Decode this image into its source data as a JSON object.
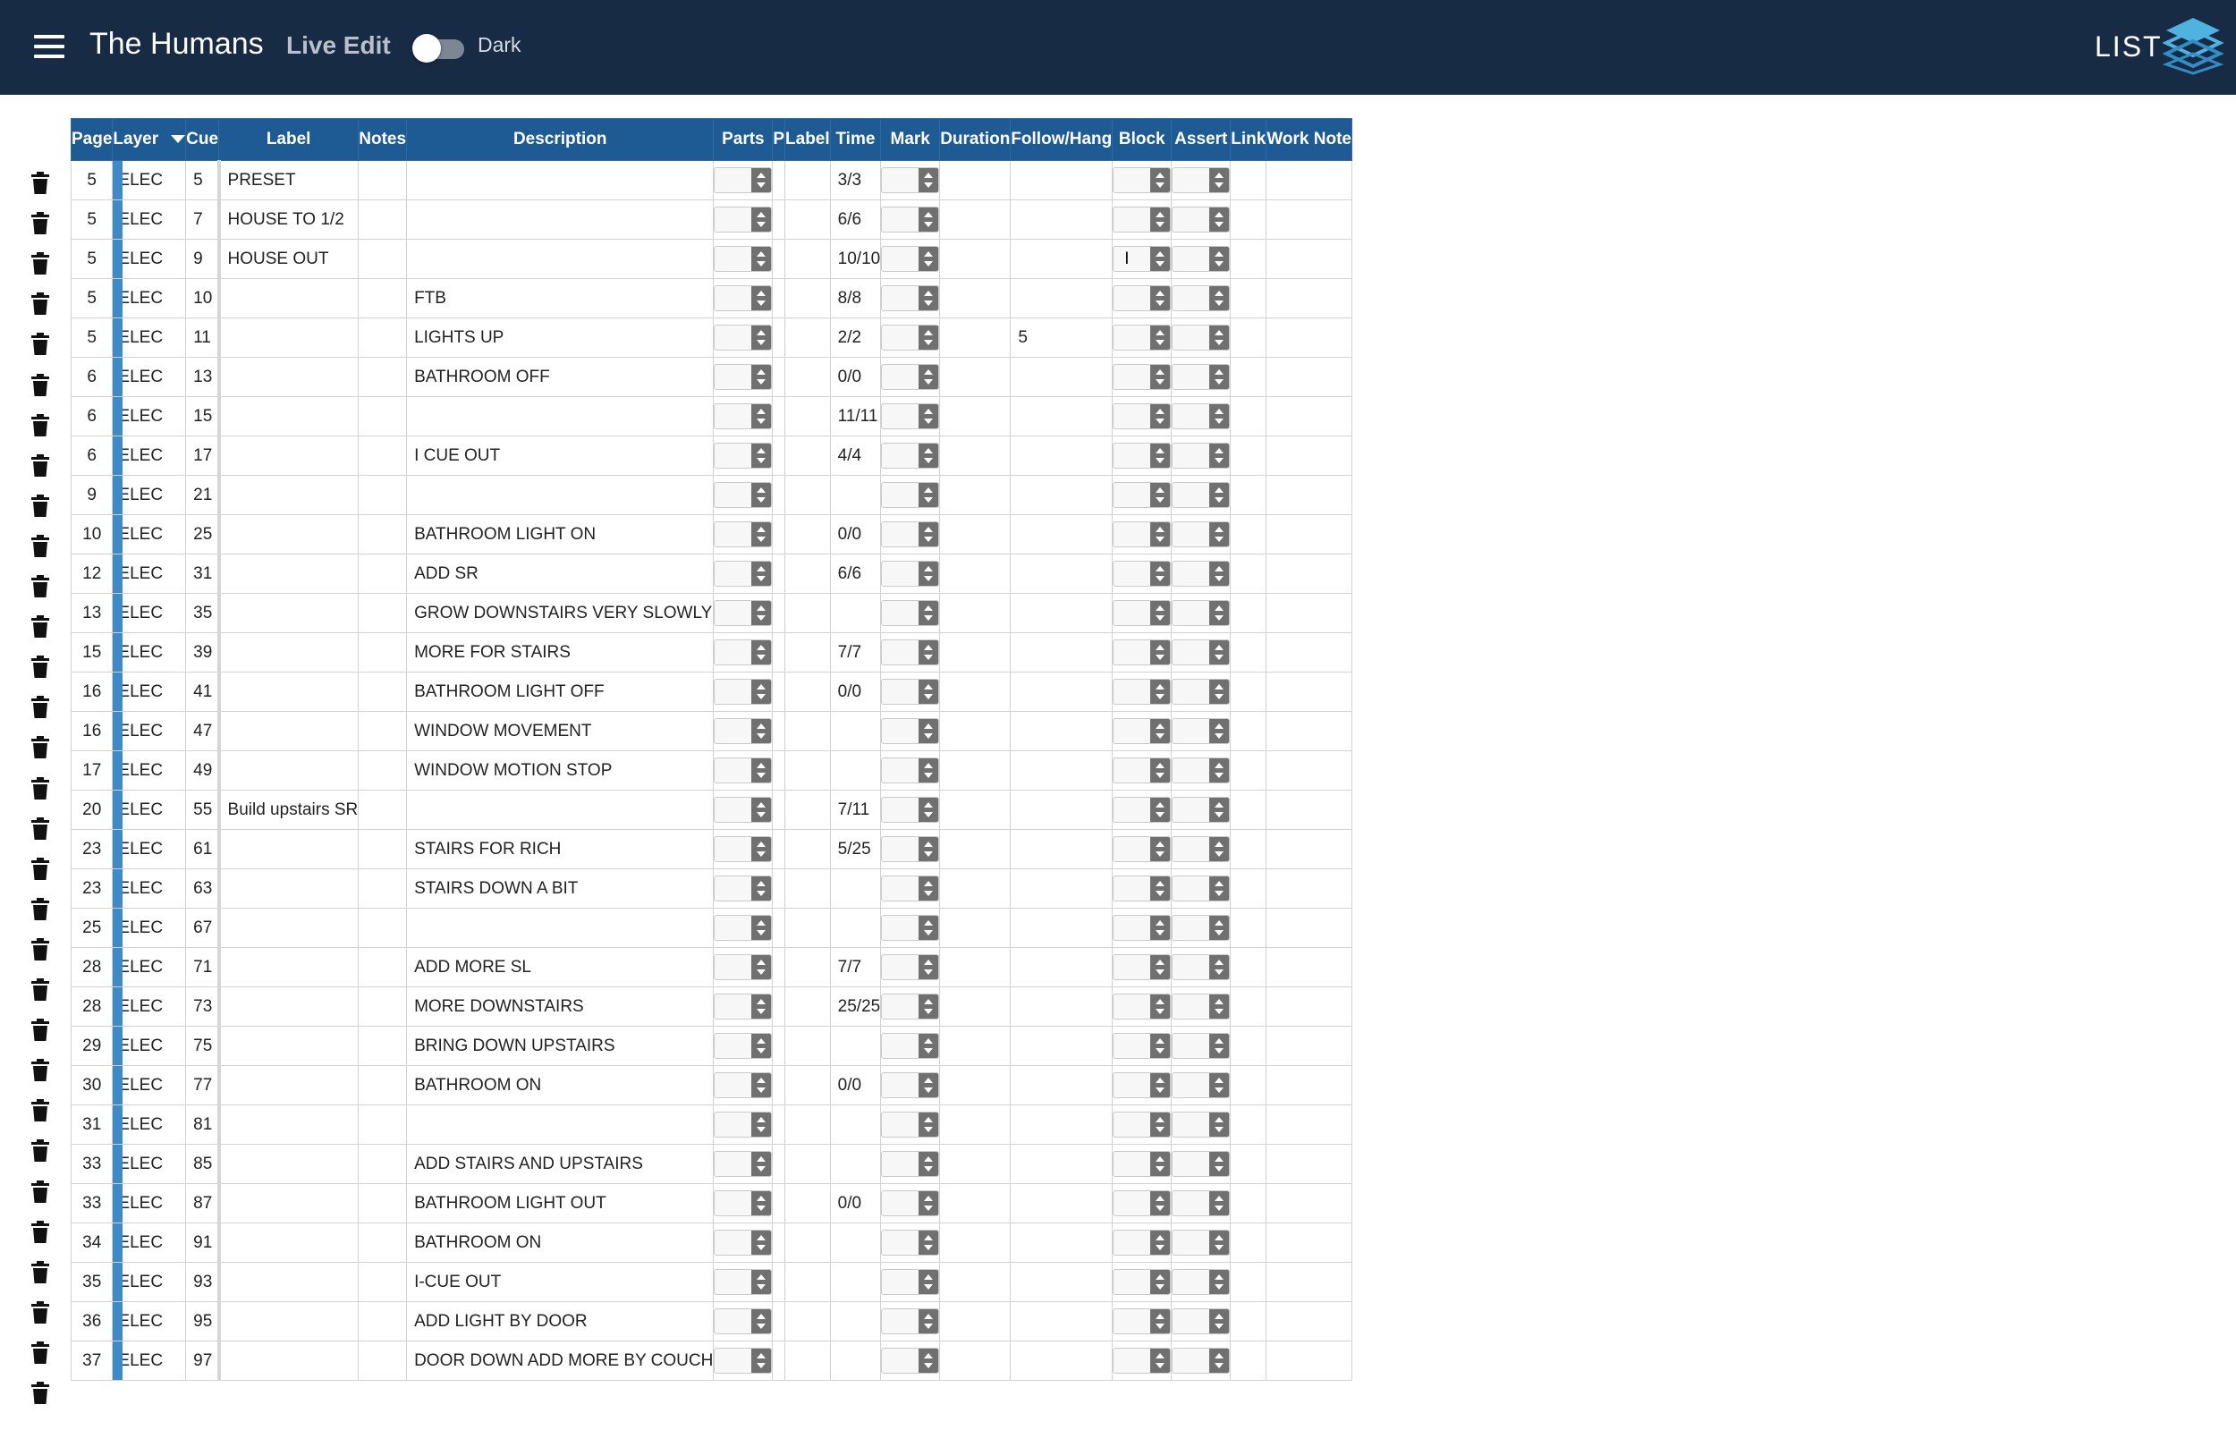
{
  "header": {
    "title": "The Humans",
    "live_edit": "Live Edit",
    "dark_label": "Dark",
    "logo_text": "LIST",
    "menu_icon": "hamburger-menu-icon",
    "dark_toggle_on": false,
    "colors": {
      "header_bg": "#172b45",
      "table_header_bg": "#1e5b94",
      "layer_bar": "#3d8ac8"
    }
  },
  "columns": {
    "page": "Page",
    "layer": "Layer",
    "cue": "Cue",
    "label": "Label",
    "notes": "Notes",
    "description": "Description",
    "parts": "Parts",
    "p": "P",
    "label2": "Label",
    "time": "Time",
    "mark": "Mark",
    "duration": "Duration",
    "follow_hang": "Follow/Hang",
    "block": "Block",
    "assert": "Assert",
    "link": "Link",
    "work_note": "Work Note"
  },
  "rows": [
    {
      "page": "5",
      "layer": "ELEC",
      "cue": "5",
      "label": "PRESET",
      "notes": "",
      "description": "",
      "time": "3/3",
      "follow": "",
      "block": ""
    },
    {
      "page": "5",
      "layer": "ELEC",
      "cue": "7",
      "label": "HOUSE TO 1/2",
      "notes": "",
      "description": "",
      "time": "6/6",
      "follow": "",
      "block": ""
    },
    {
      "page": "5",
      "layer": "ELEC",
      "cue": "9",
      "label": "HOUSE OUT",
      "notes": "",
      "description": "",
      "time": "10/10",
      "follow": "",
      "block": "I"
    },
    {
      "page": "5",
      "layer": "ELEC",
      "cue": "10",
      "label": "",
      "notes": "",
      "description": "FTB",
      "time": "8/8",
      "follow": "",
      "block": ""
    },
    {
      "page": "5",
      "layer": "ELEC",
      "cue": "11",
      "label": "",
      "notes": "",
      "description": "LIGHTS UP",
      "time": "2/2",
      "follow": "5",
      "block": ""
    },
    {
      "page": "6",
      "layer": "ELEC",
      "cue": "13",
      "label": "",
      "notes": "",
      "description": "BATHROOM OFF",
      "time": "0/0",
      "follow": "",
      "block": ""
    },
    {
      "page": "6",
      "layer": "ELEC",
      "cue": "15",
      "label": "",
      "notes": "",
      "description": "",
      "time": "11/11",
      "follow": "",
      "block": ""
    },
    {
      "page": "6",
      "layer": "ELEC",
      "cue": "17",
      "label": "",
      "notes": "",
      "description": "I CUE OUT",
      "time": "4/4",
      "follow": "",
      "block": ""
    },
    {
      "page": "9",
      "layer": "ELEC",
      "cue": "21",
      "label": "",
      "notes": "",
      "description": "",
      "time": "",
      "follow": "",
      "block": ""
    },
    {
      "page": "10",
      "layer": "ELEC",
      "cue": "25",
      "label": "",
      "notes": "",
      "description": "BATHROOM LIGHT ON",
      "time": "0/0",
      "follow": "",
      "block": ""
    },
    {
      "page": "12",
      "layer": "ELEC",
      "cue": "31",
      "label": "",
      "notes": "",
      "description": "ADD SR",
      "time": "6/6",
      "follow": "",
      "block": ""
    },
    {
      "page": "13",
      "layer": "ELEC",
      "cue": "35",
      "label": "",
      "notes": "",
      "description": "GROW DOWNSTAIRS VERY SLOWLY",
      "time": "",
      "follow": "",
      "block": ""
    },
    {
      "page": "15",
      "layer": "ELEC",
      "cue": "39",
      "label": "",
      "notes": "",
      "description": "MORE FOR STAIRS",
      "time": "7/7",
      "follow": "",
      "block": ""
    },
    {
      "page": "16",
      "layer": "ELEC",
      "cue": "41",
      "label": "",
      "notes": "",
      "description": "BATHROOM LIGHT OFF",
      "time": "0/0",
      "follow": "",
      "block": ""
    },
    {
      "page": "16",
      "layer": "ELEC",
      "cue": "47",
      "label": "",
      "notes": "",
      "description": "WINDOW MOVEMENT",
      "time": "",
      "follow": "",
      "block": ""
    },
    {
      "page": "17",
      "layer": "ELEC",
      "cue": "49",
      "label": "",
      "notes": "",
      "description": "WINDOW MOTION STOP",
      "time": "",
      "follow": "",
      "block": ""
    },
    {
      "page": "20",
      "layer": "ELEC",
      "cue": "55",
      "label": "Build upstairs SR",
      "notes": "",
      "description": "",
      "time": "7/11",
      "follow": "",
      "block": ""
    },
    {
      "page": "23",
      "layer": "ELEC",
      "cue": "61",
      "label": "",
      "notes": "",
      "description": "STAIRS FOR RICH",
      "time": "5/25",
      "follow": "",
      "block": ""
    },
    {
      "page": "23",
      "layer": "ELEC",
      "cue": "63",
      "label": "",
      "notes": "",
      "description": "STAIRS DOWN A BIT",
      "time": "",
      "follow": "",
      "block": ""
    },
    {
      "page": "25",
      "layer": "ELEC",
      "cue": "67",
      "label": "",
      "notes": "",
      "description": "",
      "time": "",
      "follow": "",
      "block": ""
    },
    {
      "page": "28",
      "layer": "ELEC",
      "cue": "71",
      "label": "",
      "notes": "",
      "description": "ADD MORE SL",
      "time": "7/7",
      "follow": "",
      "block": ""
    },
    {
      "page": "28",
      "layer": "ELEC",
      "cue": "73",
      "label": "",
      "notes": "",
      "description": "MORE DOWNSTAIRS",
      "time": "25/25",
      "follow": "",
      "block": ""
    },
    {
      "page": "29",
      "layer": "ELEC",
      "cue": "75",
      "label": "",
      "notes": "",
      "description": "BRING DOWN UPSTAIRS",
      "time": "",
      "follow": "",
      "block": ""
    },
    {
      "page": "30",
      "layer": "ELEC",
      "cue": "77",
      "label": "",
      "notes": "",
      "description": "BATHROOM ON",
      "time": "0/0",
      "follow": "",
      "block": ""
    },
    {
      "page": "31",
      "layer": "ELEC",
      "cue": "81",
      "label": "",
      "notes": "",
      "description": "",
      "time": "",
      "follow": "",
      "block": ""
    },
    {
      "page": "33",
      "layer": "ELEC",
      "cue": "85",
      "label": "",
      "notes": "",
      "description": "ADD STAIRS AND UPSTAIRS",
      "time": "",
      "follow": "",
      "block": ""
    },
    {
      "page": "33",
      "layer": "ELEC",
      "cue": "87",
      "label": "",
      "notes": "",
      "description": "BATHROOM LIGHT OUT",
      "time": "0/0",
      "follow": "",
      "block": ""
    },
    {
      "page": "34",
      "layer": "ELEC",
      "cue": "91",
      "label": "",
      "notes": "",
      "description": "BATHROOM ON",
      "time": "",
      "follow": "",
      "block": ""
    },
    {
      "page": "35",
      "layer": "ELEC",
      "cue": "93",
      "label": "",
      "notes": "",
      "description": "I-CUE OUT",
      "time": "",
      "follow": "",
      "block": ""
    },
    {
      "page": "36",
      "layer": "ELEC",
      "cue": "95",
      "label": "",
      "notes": "",
      "description": "ADD LIGHT BY DOOR",
      "time": "",
      "follow": "",
      "block": ""
    },
    {
      "page": "37",
      "layer": "ELEC",
      "cue": "97",
      "label": "",
      "notes": "",
      "description": "DOOR DOWN ADD MORE BY COUCH",
      "time": "",
      "follow": "",
      "block": ""
    }
  ]
}
